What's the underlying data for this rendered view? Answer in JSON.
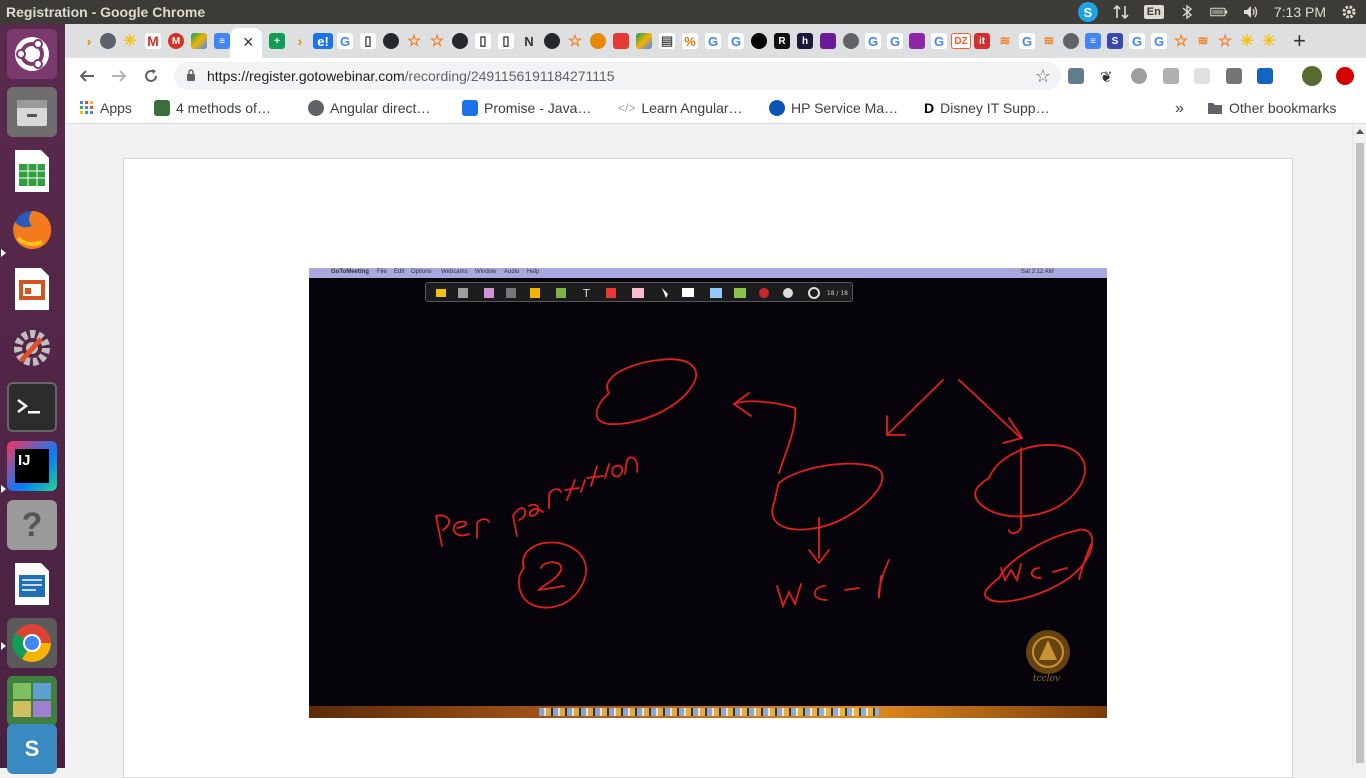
{
  "window": {
    "title": "Registration - Google Chrome"
  },
  "panel": {
    "language": "En",
    "clock": "7:13 PM"
  },
  "launcher": {
    "items": [
      "ubuntu-dash",
      "files",
      "libreoffice-calc",
      "firefox",
      "libreoffice-impress",
      "system-settings",
      "terminal",
      "intellij-idea",
      "help",
      "libreoffice-writer",
      "chrome",
      "workspace-switcher",
      "software-updater"
    ]
  },
  "tabs": {
    "active_close": "×",
    "new_tab": "+"
  },
  "toolbar": {
    "url_host": "https://register.gotowebinar.com",
    "url_path": "/recording/2491156191184271115"
  },
  "bookmarks": {
    "apps": "Apps",
    "items": [
      "4 methods of…",
      "Angular direct…",
      "Promise - Java…",
      "Learn Angular…",
      "HP Service Ma…",
      "Disney IT Supp…"
    ],
    "overflow": "»",
    "other": "Other bookmarks"
  },
  "recording": {
    "menubar_app": "GoToMeeting",
    "menubar_items": [
      "File",
      "Edit",
      "Options",
      "Webcams",
      "Window",
      "Audio",
      "Help"
    ],
    "menubar_time": "Sat 2:12 AM",
    "toolbar_counter": "18 / 18",
    "handwriting": [
      "Per partition",
      "2",
      "WC - 1",
      "WC - 1"
    ],
    "watermark": "tcclov"
  },
  "colors": {
    "ink": "#e0201e",
    "panel_bg": "#3c3b37",
    "launcher_bg": "#5a2a4e",
    "tabstrip_bg": "#dedfe1"
  }
}
